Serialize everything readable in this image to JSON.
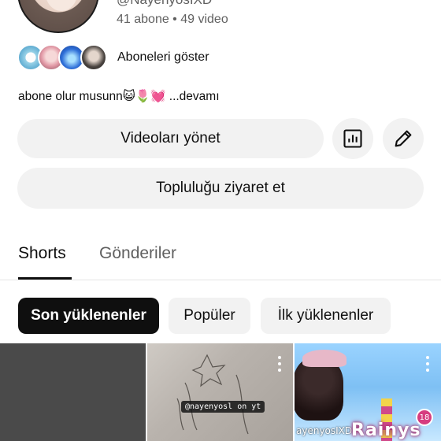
{
  "channel": {
    "handle": "@NayenyosIXD",
    "stats": "41 abone • 49 video",
    "subscribers_label": "Aboneleri göster",
    "bio": "abone olur musunn😺🌷💓 ...devamı"
  },
  "buttons": {
    "manage_videos": "Videoları yönet",
    "visit_community": "Topluluğu ziyaret et",
    "analytics_icon": "bar-chart-icon",
    "edit_icon": "pencil-icon"
  },
  "tabs": [
    {
      "label": "Shorts"
    },
    {
      "label": "Gönderiler"
    }
  ],
  "chips": [
    {
      "label": "Son yüklenenler"
    },
    {
      "label": "Popüler"
    },
    {
      "label": "İlk yüklenenler"
    }
  ],
  "thumbnails": [
    {
      "caption": ""
    },
    {
      "caption": "@nayenyosl on yt"
    },
    {
      "caption": "ayenyosIXD",
      "logo": "Rainys",
      "badge": "18"
    }
  ],
  "colors": {
    "text_primary": "#0f0f0f",
    "text_secondary": "#606060",
    "chip_bg": "#f2f2f2",
    "chip_active_bg": "#0f0f0f"
  }
}
